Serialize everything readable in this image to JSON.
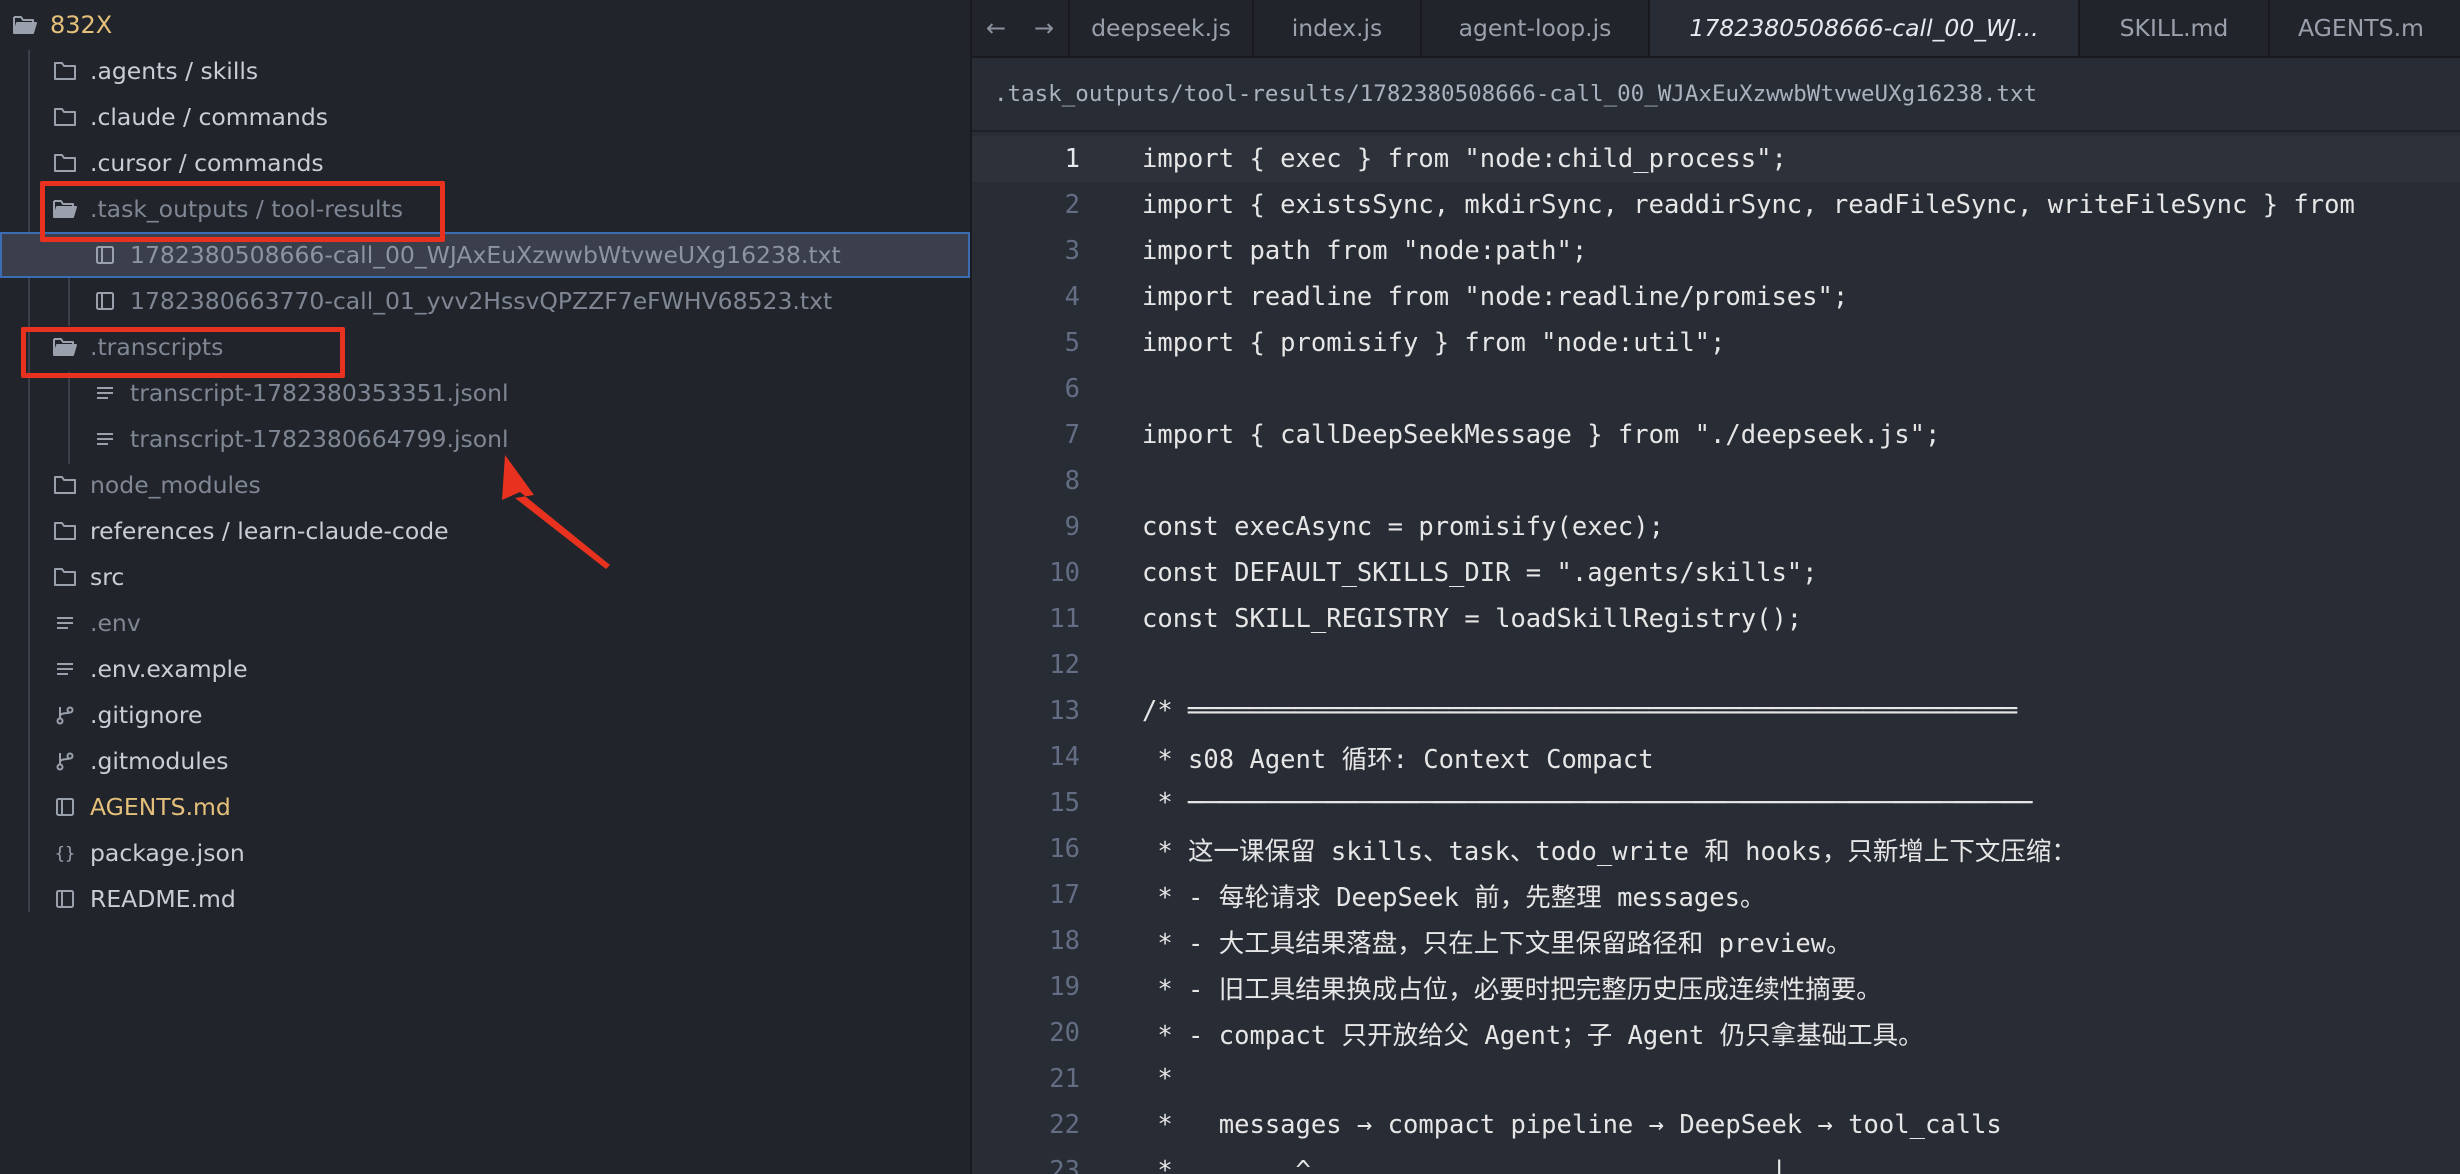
{
  "sidebar": {
    "root": {
      "label": "832X",
      "icon": "folder-open-icon"
    },
    "items": [
      {
        "label": ".agents / skills",
        "icon": "folder-icon",
        "style": "normal",
        "indent": 1
      },
      {
        "label": ".claude / commands",
        "icon": "folder-icon",
        "style": "normal",
        "indent": 1
      },
      {
        "label": ".cursor / commands",
        "icon": "folder-icon",
        "style": "normal",
        "indent": 1
      },
      {
        "label": ".task_outputs / tool-results",
        "icon": "folder-open-icon",
        "style": "dim",
        "indent": 1
      },
      {
        "label": "1782380508666-call_00_WJAxEuXzwwbWtvweUXg16238.txt",
        "icon": "book-icon",
        "style": "selected",
        "indent": 2
      },
      {
        "label": "1782380663770-call_01_yvv2HssvQPZZF7eFWHV68523.txt",
        "icon": "book-icon",
        "style": "dim",
        "indent": 2
      },
      {
        "label": ".transcripts",
        "icon": "folder-open-icon",
        "style": "dim",
        "indent": 1
      },
      {
        "label": "transcript-1782380353351.jsonl",
        "icon": "lines-icon",
        "style": "dim",
        "indent": 2
      },
      {
        "label": "transcript-1782380664799.jsonl",
        "icon": "lines-icon",
        "style": "dim",
        "indent": 2
      },
      {
        "label": "node_modules",
        "icon": "folder-icon",
        "style": "dim",
        "indent": 1
      },
      {
        "label": "references / learn-claude-code",
        "icon": "folder-icon",
        "style": "normal",
        "indent": 1
      },
      {
        "label": "src",
        "icon": "folder-icon",
        "style": "normal",
        "indent": 1
      },
      {
        "label": ".env",
        "icon": "lines-icon",
        "style": "dim",
        "indent": 1
      },
      {
        "label": ".env.example",
        "icon": "lines-icon",
        "style": "normal",
        "indent": 1
      },
      {
        "label": ".gitignore",
        "icon": "git-icon",
        "style": "normal",
        "indent": 1
      },
      {
        "label": ".gitmodules",
        "icon": "git-icon",
        "style": "normal",
        "indent": 1
      },
      {
        "label": "AGENTS.md",
        "icon": "book-icon",
        "style": "yellow",
        "indent": 1
      },
      {
        "label": "package.json",
        "icon": "braces-icon",
        "style": "normal",
        "indent": 1
      },
      {
        "label": "README.md",
        "icon": "book-icon",
        "style": "normal",
        "indent": 1
      }
    ]
  },
  "colors": {
    "annotation_red": "#e8321f",
    "selection_border": "#3b6cb4",
    "root_yellow": "#e5c07b"
  },
  "editor": {
    "nav": {
      "back": "←",
      "forward": "→"
    },
    "tabs": [
      {
        "label": "deepseek.js",
        "active": false
      },
      {
        "label": "index.js",
        "active": false
      },
      {
        "label": "agent-loop.js",
        "active": false
      },
      {
        "label": "1782380508666-call_00_WJ...",
        "active": true
      },
      {
        "label": "SKILL.md",
        "active": false
      },
      {
        "label": "AGENTS.m",
        "active": false
      }
    ],
    "path": ".task_outputs/tool-results/1782380508666-call_00_WJAxEuXzwwbWtvweUXg16238.txt",
    "current_line": 1,
    "lines": [
      "import { exec } from \"node:child_process\";",
      "import { existsSync, mkdirSync, readdirSync, readFileSync, writeFileSync } from",
      "import path from \"node:path\";",
      "import readline from \"node:readline/promises\";",
      "import { promisify } from \"node:util\";",
      "",
      "import { callDeepSeekMessage } from \"./deepseek.js\";",
      "",
      "const execAsync = promisify(exec);",
      "const DEFAULT_SKILLS_DIR = \".agents/skills\";",
      "const SKILL_REGISTRY = loadSkillRegistry();",
      "",
      "/* ══════════════════════════════════════════════════════",
      " * s08 Agent 循环: Context Compact",
      " * ───────────────────────────────────────────────────────",
      " * 这一课保留 skills、task、todo_write 和 hooks，只新增上下文压缩：",
      " * - 每轮请求 DeepSeek 前，先整理 messages。",
      " * - 大工具结果落盘，只在上下文里保留路径和 preview。",
      " * - 旧工具结果换成占位，必要时把完整历史压成连续性摘要。",
      " * - compact 只开放给父 Agent；子 Agent 仍只拿基础工具。",
      " *",
      " *   messages → compact pipeline → DeepSeek → tool_calls",
      " *        ^                              |"
    ]
  }
}
